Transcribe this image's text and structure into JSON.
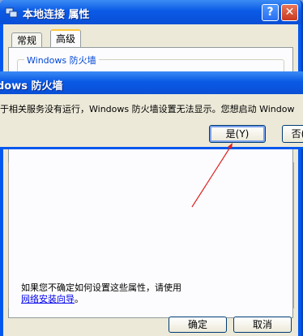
{
  "properties_window": {
    "title": "本地连接 属性",
    "help_label": "?",
    "close_label": "✕",
    "tabs": [
      {
        "label": "常规"
      },
      {
        "label": "高级"
      }
    ],
    "group_legend": "Windows 防火墙",
    "help_text": "如果您不确定如何设置这些属性，请使用",
    "help_link": "网络安装向导",
    "help_link_suffix": "。",
    "ok_label": "确定",
    "cancel_label": "取消"
  },
  "alert_dialog": {
    "title": "dows 防火墙",
    "message": "于相关服务没有运行，Windows 防火墙设置无法显示。您想启动 Window",
    "yes_label": "是(Y)",
    "no_label": "否("
  },
  "annotation": {
    "arrow_color": "#e02020"
  },
  "colors": {
    "titlebar": "#0a5ae6",
    "dialog_face": "#ece9d8",
    "link": "#0000ee"
  }
}
